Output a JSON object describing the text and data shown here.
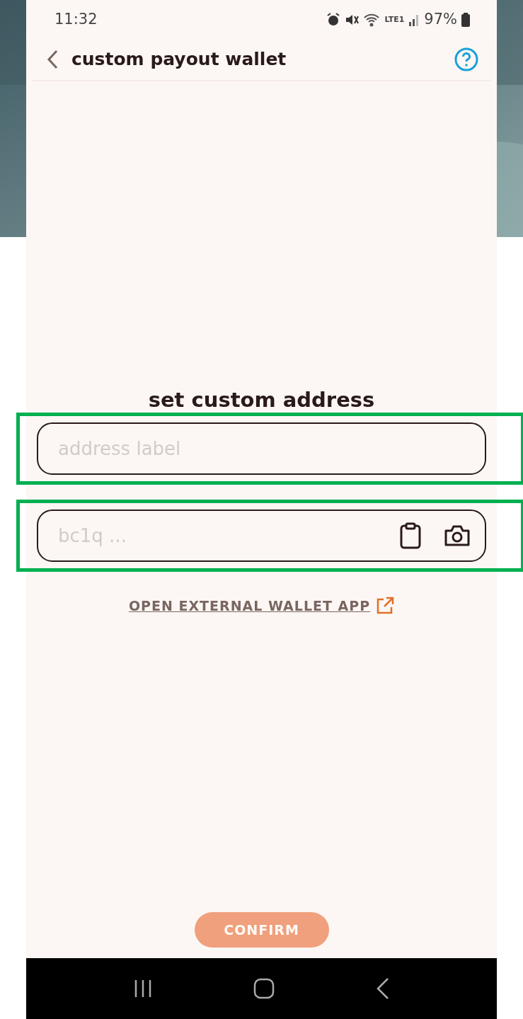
{
  "status_bar": {
    "time": "11:32",
    "battery": "97%",
    "network": "LTE1"
  },
  "header": {
    "title": "custom payout wallet"
  },
  "form": {
    "heading": "set custom address",
    "fields": [
      {
        "kind": "text",
        "placeholder": "address label",
        "highlighted": true
      },
      {
        "kind": "address",
        "placeholder": "bc1q ...",
        "highlighted": true
      }
    ],
    "link": "OPEN EXTERNAL WALLET APP"
  },
  "confirm": {
    "label": "CONFIRM",
    "disabled": true
  }
}
